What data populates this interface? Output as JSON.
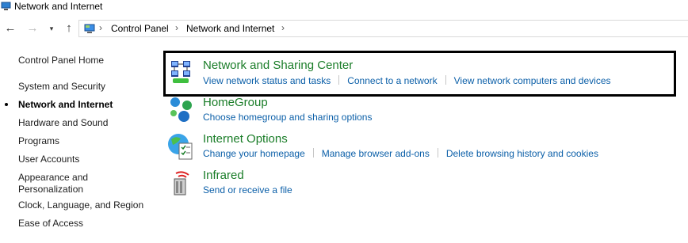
{
  "window": {
    "title": "Network and Internet"
  },
  "nav": {
    "back_icon": "arrow-left-icon",
    "forward_icon": "arrow-right-icon",
    "recent_icon": "chevron-down-icon",
    "up_icon": "arrow-up-icon",
    "breadcrumbs": [
      "Control Panel",
      "Network and Internet"
    ]
  },
  "sidebar": {
    "home": "Control Panel Home",
    "items": [
      {
        "label": "System and Security",
        "active": false
      },
      {
        "label": "Network and Internet",
        "active": true
      },
      {
        "label": "Hardware and Sound",
        "active": false
      },
      {
        "label": "Programs",
        "active": false
      },
      {
        "label": "User Accounts",
        "active": false
      },
      {
        "label": "Appearance and Personalization",
        "active": false
      },
      {
        "label": "Clock, Language, and Region",
        "active": false
      },
      {
        "label": "Ease of Access",
        "active": false
      }
    ],
    "appearance_line1": "Appearance and",
    "appearance_line2": "Personalization"
  },
  "categories": [
    {
      "title": "Network and Sharing Center",
      "icon": "network-sharing-icon",
      "links": [
        "View network status and tasks",
        "Connect to a network",
        "View network computers and devices"
      ]
    },
    {
      "title": "HomeGroup",
      "icon": "homegroup-icon",
      "links": [
        "Choose homegroup and sharing options"
      ]
    },
    {
      "title": "Internet Options",
      "icon": "internet-options-icon",
      "links": [
        "Change your homepage",
        "Manage browser add-ons",
        "Delete browsing history and cookies"
      ]
    },
    {
      "title": "Infrared",
      "icon": "infrared-icon",
      "links": [
        "Send or receive a file"
      ]
    }
  ],
  "colors": {
    "category_title": "#1a7d28",
    "link": "#0b5fa8",
    "highlight_border": "#000000"
  }
}
